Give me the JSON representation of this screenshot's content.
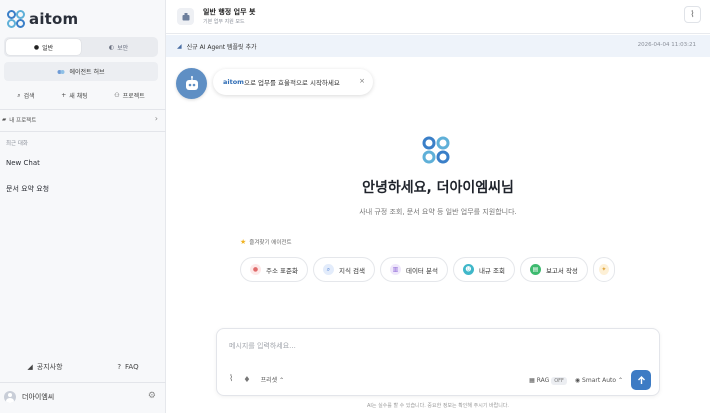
{
  "sidebar": {
    "logo_text": "aitom",
    "mode_tabs": [
      {
        "label": "일반",
        "active": true
      },
      {
        "label": "보안",
        "active": false
      }
    ],
    "agent_hub_label": "에이전트 허브",
    "quick_actions": [
      {
        "label": "검색",
        "icon": "search-icon"
      },
      {
        "label": "새 채팅",
        "icon": "plus-icon"
      },
      {
        "label": "프로젝트",
        "icon": "project-icon"
      }
    ],
    "projects_label": "내 프로젝트",
    "recent_label": "최근 대화",
    "chats": [
      "New Chat",
      "문서 요약 요청"
    ],
    "bottom_links": [
      {
        "label": "공지사항",
        "icon": "megaphone-icon"
      },
      {
        "label": "FAQ",
        "icon": "help-icon"
      }
    ],
    "user_name": "더아이엠씨"
  },
  "header": {
    "bot_title": "일반 행정 업무 봇",
    "bot_subtitle": "기본 업무 지원 모드"
  },
  "notice": {
    "text": "신규 AI Agent 템플릿 추가",
    "time": "2026-04-04 11:03:21"
  },
  "onboarding": {
    "brand": "aitom",
    "message": "으로 업무를 효율적으로 시작하세요",
    "close": "×"
  },
  "welcome": {
    "greeting": "안녕하세요, 더아이엠씨님",
    "subtitle": "사내 규정 조회, 문서 요약 등 일반 업무를 지원합니다."
  },
  "favorites": {
    "label": "즐겨찾기 에이전트",
    "chips": [
      {
        "label": "주소 표준화",
        "color": "#f08a8a"
      },
      {
        "label": "지식 검색",
        "color": "#5b8de0"
      },
      {
        "label": "데이터 분석",
        "color": "#9b7be0"
      },
      {
        "label": "내규 조회",
        "color": "#3fb7c9"
      },
      {
        "label": "보고서 작성",
        "color": "#3dba6f"
      }
    ]
  },
  "composer": {
    "placeholder": "메시지를 입력하세요...",
    "prompt_label": "프리셋",
    "rag_label": "RAG",
    "rag_state": "OFF",
    "model_label": "Smart Auto"
  },
  "footer_note": "AI는 실수를 할 수 있습니다. 중요한 정보는 확인해 주시기 바랍니다.",
  "colors": {
    "accent": "#3d7bc4",
    "brand_blue": "#2f6db5"
  }
}
